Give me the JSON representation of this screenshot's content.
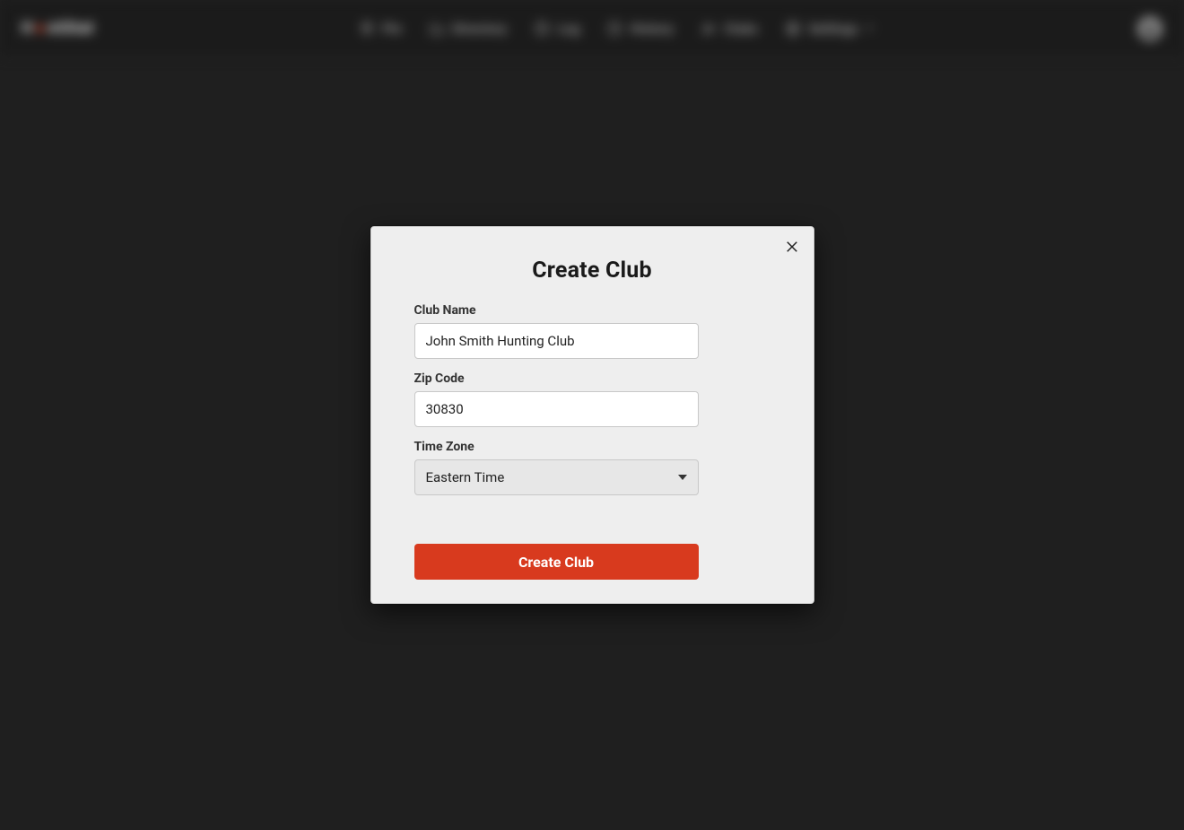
{
  "brand": {
    "prefix": "H",
    "glyph": "●",
    "suffix": "ntStat"
  },
  "nav": {
    "items": [
      {
        "label": "Pin"
      },
      {
        "label": "Directory"
      },
      {
        "label": "Log"
      },
      {
        "label": "History"
      },
      {
        "label": "Clubs"
      },
      {
        "label": "Settings"
      }
    ]
  },
  "modal": {
    "title": "Create Club",
    "club_name_label": "Club Name",
    "club_name_value": "John Smith Hunting Club",
    "zip_label": "Zip Code",
    "zip_value": "30830",
    "tz_label": "Time Zone",
    "tz_value": "Eastern Time",
    "submit_label": "Create Club"
  }
}
